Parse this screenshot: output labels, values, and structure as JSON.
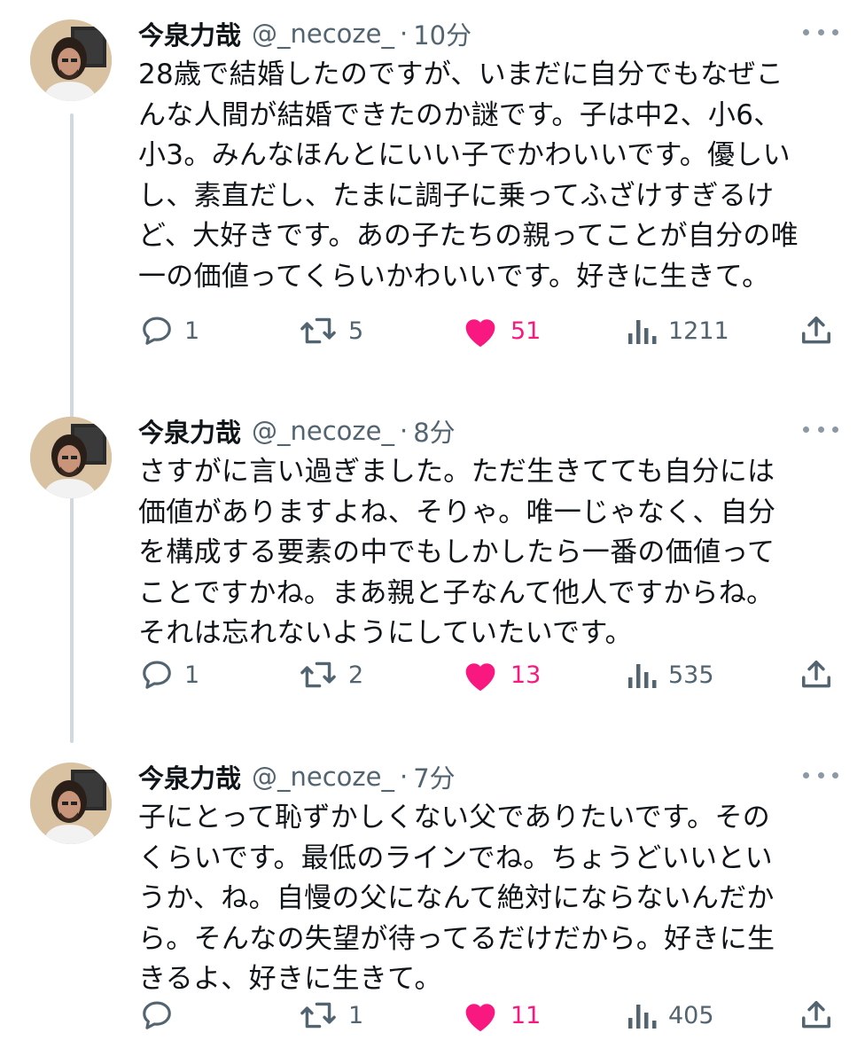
{
  "tweets": [
    {
      "name": "今泉力哉",
      "handle": "@_necoze_",
      "separator": "·",
      "time": "10分",
      "lines": [
        "28歳で結婚したのですが、いまだに自分でもなぜこ",
        "んな人間が結婚できたのか謎です。子は中2、小6、",
        "小3。みんなほんとにいい子でかわいいです。優しい",
        "し、素直だし、たまに調子に乗ってふざけすぎるけ",
        "ど、大好きです。あの子たちの親ってことが自分の唯",
        "一の価値ってくらいかわいいです。好きに生きて。"
      ],
      "replies": "1",
      "retweets": "5",
      "likes": "51",
      "views": "1211"
    },
    {
      "name": "今泉力哉",
      "handle": "@_necoze_",
      "separator": "·",
      "time": "8分",
      "lines": [
        "さすがに言い過ぎました。ただ生きてても自分には",
        "価値がありますよね、そりゃ。唯一じゃなく、自分",
        "を構成する要素の中でもしかしたら一番の価値って",
        "ことですかね。まあ親と子なんて他人ですからね。",
        "それは忘れないようにしていたいです。"
      ],
      "replies": "1",
      "retweets": "2",
      "likes": "13",
      "views": "535"
    },
    {
      "name": "今泉力哉",
      "handle": "@_necoze_",
      "separator": "·",
      "time": "7分",
      "lines": [
        "子にとって恥ずかしくない父でありたいです。その",
        "くらいです。最低のラインでね。ちょうどいいとい",
        "うか、ね。自慢の父になんて絶対にならないんだか",
        "ら。そんなの失望が待ってるだけだから。好きに生",
        "きるよ、好きに生きて。"
      ],
      "replies": "",
      "retweets": "1",
      "likes": "11",
      "views": "405"
    }
  ],
  "colors": {
    "like": "#f91880",
    "secondary": "#536471",
    "thread_line": "#cfd9de"
  },
  "icons": [
    "reply-icon",
    "retweet-icon",
    "like-heart-icon",
    "views-chart-icon",
    "share-upload-icon",
    "more-dots-icon"
  ]
}
